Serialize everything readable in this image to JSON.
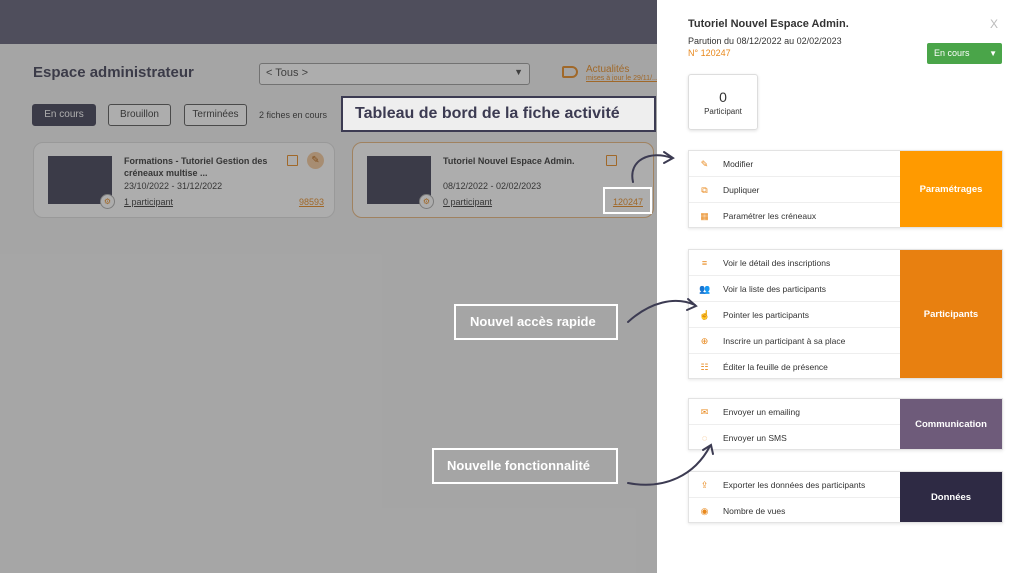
{
  "background_app": {
    "title": "Espace administrateur",
    "filter_select": "< Tous >",
    "news": {
      "label": "Actualités",
      "sublabel": "mises à jour le 29/11/..."
    },
    "tabs": [
      {
        "label": "En cours"
      },
      {
        "label": "Brouillon"
      },
      {
        "label": "Terminées"
      }
    ],
    "count_label": "2 fiches en cours",
    "cards": [
      {
        "title": "Formations - Tutoriel Gestion des créneaux multise ...",
        "dates": "23/10/2022 - 31/12/2022",
        "participants": "1 participant",
        "number": "98593"
      },
      {
        "title": "Tutoriel Nouvel Espace Admin.",
        "dates": "08/12/2022 - 02/02/2023",
        "participants": "0 participant",
        "number": "120247"
      }
    ]
  },
  "callouts": {
    "dashboard": "Tableau de bord de la fiche activité",
    "quick_access": "Nouvel accès rapide",
    "new_feature": "Nouvelle fonctionnalité"
  },
  "panel": {
    "title": "Tutoriel Nouvel Espace Admin.",
    "close": "X",
    "dates": "Parution du 08/12/2022 au 02/02/2023",
    "number": "N° 120247",
    "status": "En cours",
    "participant_count": "0",
    "participant_label": "Participant",
    "groups": {
      "parametrages": {
        "label": "Paramétrages",
        "items": [
          {
            "label": "Modifier",
            "icon": "pencil-icon"
          },
          {
            "label": "Dupliquer",
            "icon": "copy-icon"
          },
          {
            "label": "Paramétrer les créneaux",
            "icon": "calendar-icon"
          }
        ]
      },
      "participants": {
        "label": "Participants",
        "items": [
          {
            "label": "Voir le détail des inscriptions",
            "icon": "list-icon"
          },
          {
            "label": "Voir la liste des participants",
            "icon": "people-icon"
          },
          {
            "label": "Pointer les participants",
            "icon": "hand-pointer-icon"
          },
          {
            "label": "Inscrire un participant à sa place",
            "icon": "plus-circle-icon"
          },
          {
            "label": "Éditer la feuille de présence",
            "icon": "checklist-icon"
          }
        ]
      },
      "communication": {
        "label": "Communication",
        "items": [
          {
            "label": "Envoyer un emailing",
            "icon": "envelope-icon"
          },
          {
            "label": "Envoyer un SMS",
            "icon": "chat-bubble-icon"
          }
        ]
      },
      "donnees": {
        "label": "Données",
        "items": [
          {
            "label": "Exporter les données des participants",
            "icon": "export-icon"
          },
          {
            "label": "Nombre de vues",
            "icon": "eye-icon"
          }
        ]
      }
    }
  },
  "colors": {
    "topbar": "#4f4e5c",
    "accent_orange": "#e8881c",
    "status_green": "#4aa549",
    "param_orange": "#ff9a00",
    "participants_orange": "#e88010",
    "communication_purple": "#6e5b7a",
    "donnees_navy": "#2e2a44"
  }
}
